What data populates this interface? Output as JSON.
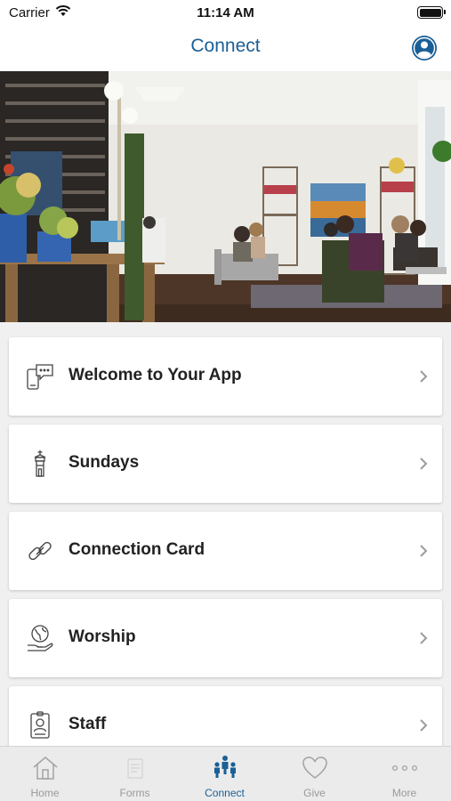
{
  "status_bar": {
    "carrier": "Carrier",
    "time": "11:14 AM"
  },
  "nav": {
    "title": "Connect"
  },
  "items": [
    {
      "label": "Welcome to Your App",
      "icon": "phone-chat-icon"
    },
    {
      "label": "Sundays",
      "icon": "steeple-icon"
    },
    {
      "label": "Connection Card",
      "icon": "link-icon"
    },
    {
      "label": "Worship",
      "icon": "globe-hand-icon"
    },
    {
      "label": "Staff",
      "icon": "id-badge-icon"
    }
  ],
  "tabs": [
    {
      "label": "Home",
      "icon": "home-icon",
      "active": false
    },
    {
      "label": "Forms",
      "icon": "forms-icon",
      "active": false
    },
    {
      "label": "Connect",
      "icon": "people-icon",
      "active": true
    },
    {
      "label": "Give",
      "icon": "heart-icon",
      "active": false
    },
    {
      "label": "More",
      "icon": "ellipsis-icon",
      "active": false
    }
  ],
  "colors": {
    "accent": "#1a5f96",
    "inactive": "#9a9a9a",
    "card_text": "#222222"
  }
}
